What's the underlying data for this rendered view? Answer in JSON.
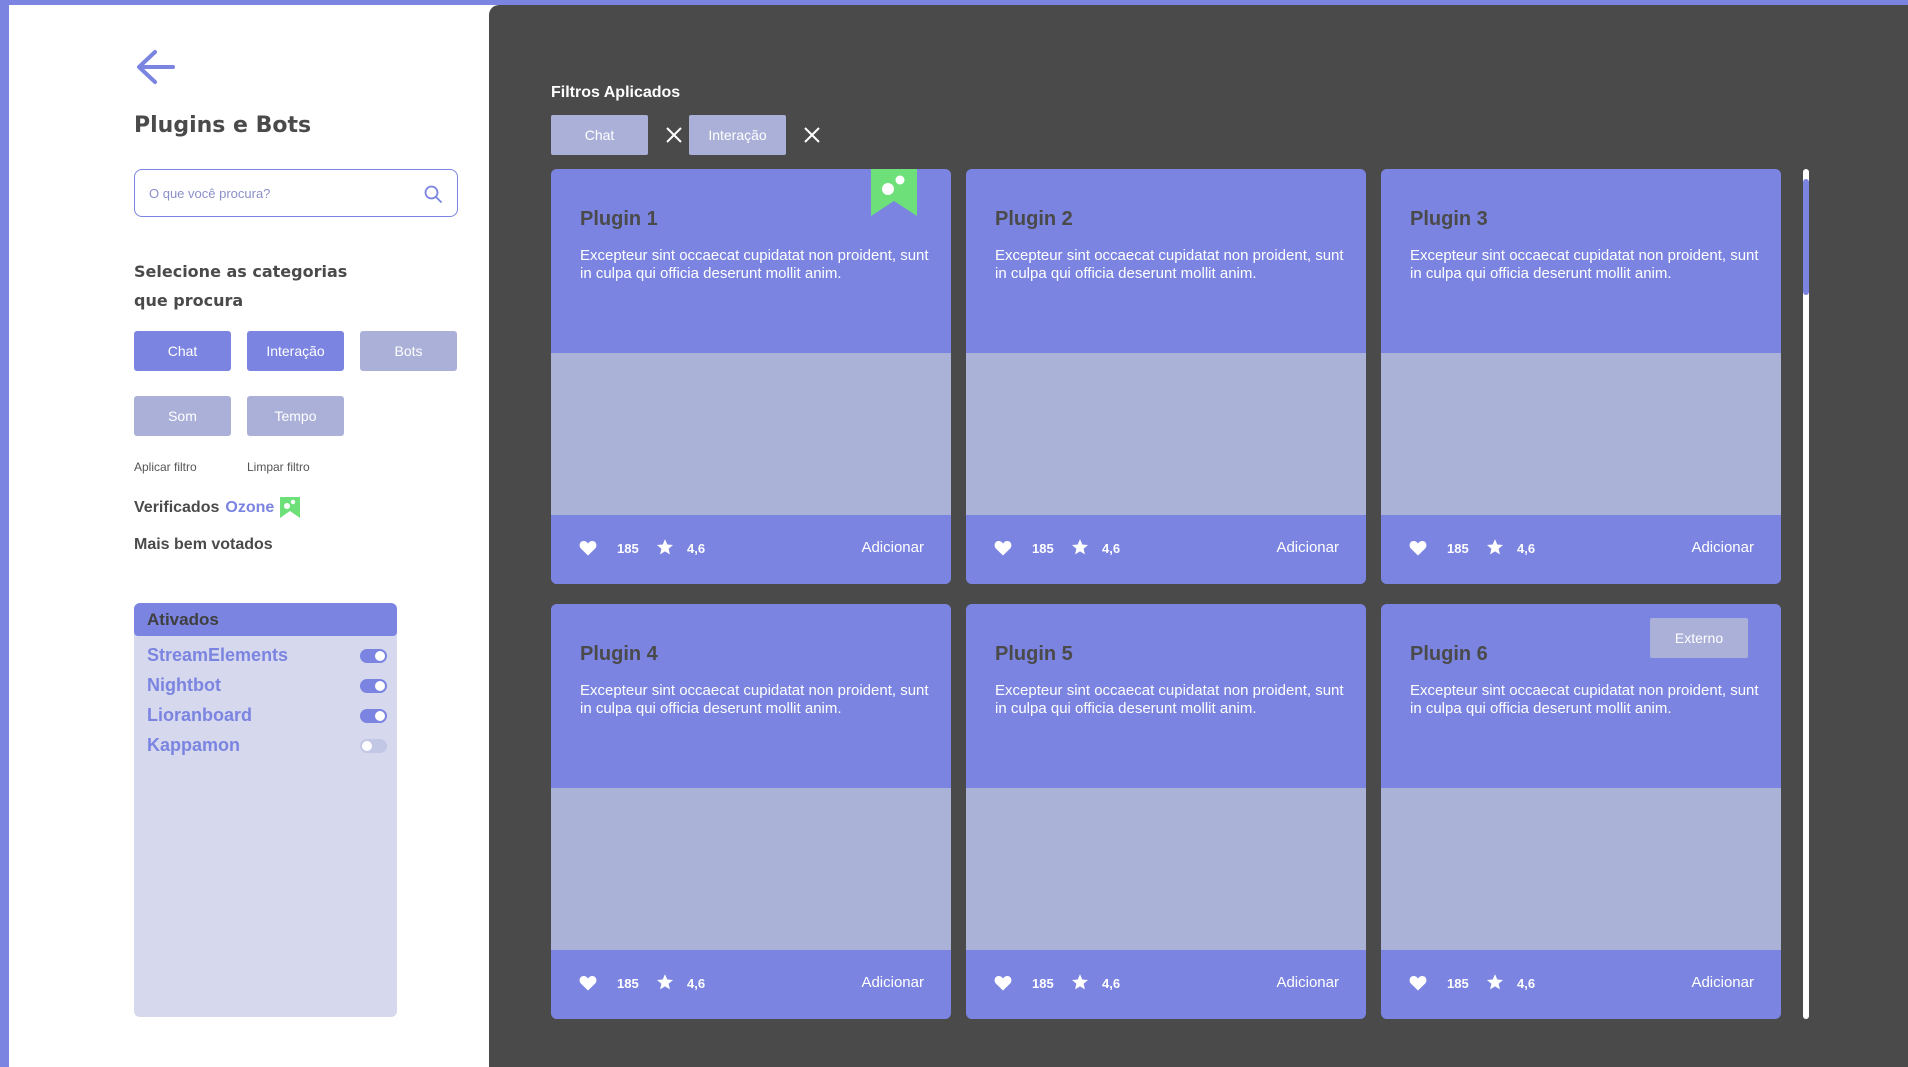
{
  "sidebar": {
    "title": "Plugins e Bots",
    "search_placeholder": "O que você procura?",
    "category_heading_line1": "Selecione as categorias",
    "category_heading_line2": "que procura",
    "categories": [
      {
        "label": "Chat",
        "selected": true
      },
      {
        "label": "Interação",
        "selected": true
      },
      {
        "label": "Bots",
        "selected": false
      },
      {
        "label": "Som",
        "selected": false
      },
      {
        "label": "Tempo",
        "selected": false
      }
    ],
    "apply_filter": "Aplicar filtro",
    "clear_filter": "Limpar filtro",
    "verified_prefix": "Verificados",
    "verified_brand": "Ozone",
    "top_voted": "Mais bem votados",
    "active_panel": {
      "title": "Ativados",
      "items": [
        {
          "label": "StreamElements",
          "enabled": true
        },
        {
          "label": "Nightbot",
          "enabled": true
        },
        {
          "label": "Lioranboard",
          "enabled": true
        },
        {
          "label": "Kappamon",
          "enabled": false
        }
      ]
    }
  },
  "main": {
    "filters_title": "Filtros Aplicados",
    "applied_filters": [
      "Chat",
      "Interação"
    ],
    "cards": [
      {
        "title": "Plugin 1",
        "description": "Excepteur sint occaecat cupidatat non proident, sunt in culpa qui officia deserunt mollit anim.",
        "likes": "185",
        "rating": "4,6",
        "action": "Adicionar",
        "verified": true
      },
      {
        "title": "Plugin 2",
        "description": "Excepteur sint occaecat cupidatat non proident, sunt in culpa qui officia deserunt mollit anim.",
        "likes": "185",
        "rating": "4,6",
        "action": "Adicionar"
      },
      {
        "title": "Plugin 3",
        "description": "Excepteur sint occaecat cupidatat non proident, sunt in culpa qui officia deserunt mollit anim.",
        "likes": "185",
        "rating": "4,6",
        "action": "Adicionar"
      },
      {
        "title": "Plugin 4",
        "description": "Excepteur sint occaecat cupidatat non proident, sunt in culpa qui officia deserunt mollit anim.",
        "likes": "185",
        "rating": "4,6",
        "action": "Adicionar"
      },
      {
        "title": "Plugin 5",
        "description": "Excepteur sint occaecat cupidatat non proident, sunt in culpa qui officia deserunt mollit anim.",
        "likes": "185",
        "rating": "4,6",
        "action": "Adicionar"
      },
      {
        "title": "Plugin 6",
        "description": "Excepteur sint occaecat cupidatat non proident, sunt in culpa qui officia deserunt mollit anim.",
        "likes": "185",
        "rating": "4,6",
        "action": "Adicionar",
        "badge": "Externo"
      }
    ]
  },
  "colors": {
    "accent": "#7b84e0",
    "muted": "#aab0d8",
    "panel": "#d6d9ee",
    "dark_bg": "#4a4a4a",
    "verified_green": "#6ee07a"
  },
  "icons": [
    "back-arrow-icon",
    "search-icon",
    "verified-ribbon-icon",
    "close-icon",
    "heart-icon",
    "star-icon"
  ]
}
